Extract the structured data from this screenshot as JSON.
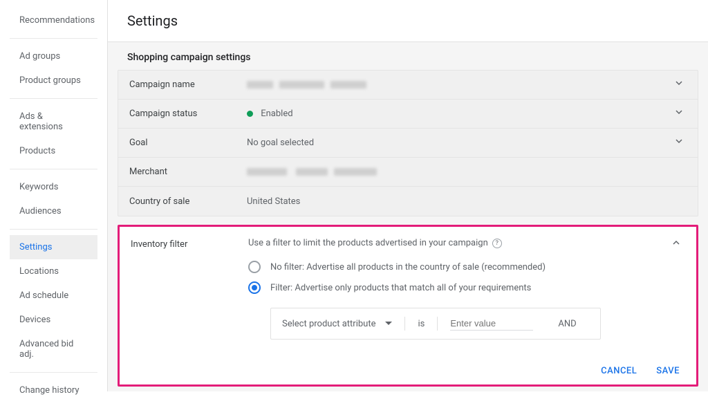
{
  "sidebar": {
    "groups": [
      {
        "items": [
          {
            "label": "Recommendations"
          }
        ]
      },
      {
        "items": [
          {
            "label": "Ad groups"
          },
          {
            "label": "Product groups"
          }
        ]
      },
      {
        "items": [
          {
            "label": "Ads & extensions"
          },
          {
            "label": "Products"
          }
        ]
      },
      {
        "items": [
          {
            "label": "Keywords"
          },
          {
            "label": "Audiences"
          }
        ]
      },
      {
        "items": [
          {
            "label": "Settings",
            "active": true
          },
          {
            "label": "Locations"
          },
          {
            "label": "Ad schedule"
          },
          {
            "label": "Devices"
          },
          {
            "label": "Advanced bid adj."
          }
        ]
      },
      {
        "items": [
          {
            "label": "Change history"
          }
        ]
      }
    ]
  },
  "page_title": "Settings",
  "section_title": "Shopping campaign settings",
  "campaign_rows": {
    "name_label": "Campaign name",
    "status_label": "Campaign status",
    "status_value": "Enabled",
    "status_color": "#0f9d58",
    "goal_label": "Goal",
    "goal_value": "No goal selected",
    "merchant_label": "Merchant",
    "country_label": "Country of sale",
    "country_value": "United States"
  },
  "inventory": {
    "heading": "Inventory filter",
    "help": "Use a filter to limit the products advertised in your campaign",
    "radio_no": "No filter: Advertise all products in the country of sale (recommended)",
    "radio_yes": "Filter: Advertise only products that match all of your requirements",
    "selected": "yes",
    "attr_placeholder": "Select product attribute",
    "op": "is",
    "value_placeholder": "Enter value",
    "and_label": "AND"
  },
  "buttons": {
    "cancel": "CANCEL",
    "save": "SAVE"
  },
  "accent_color": "#1a73e8",
  "highlight_color": "#e31c79"
}
